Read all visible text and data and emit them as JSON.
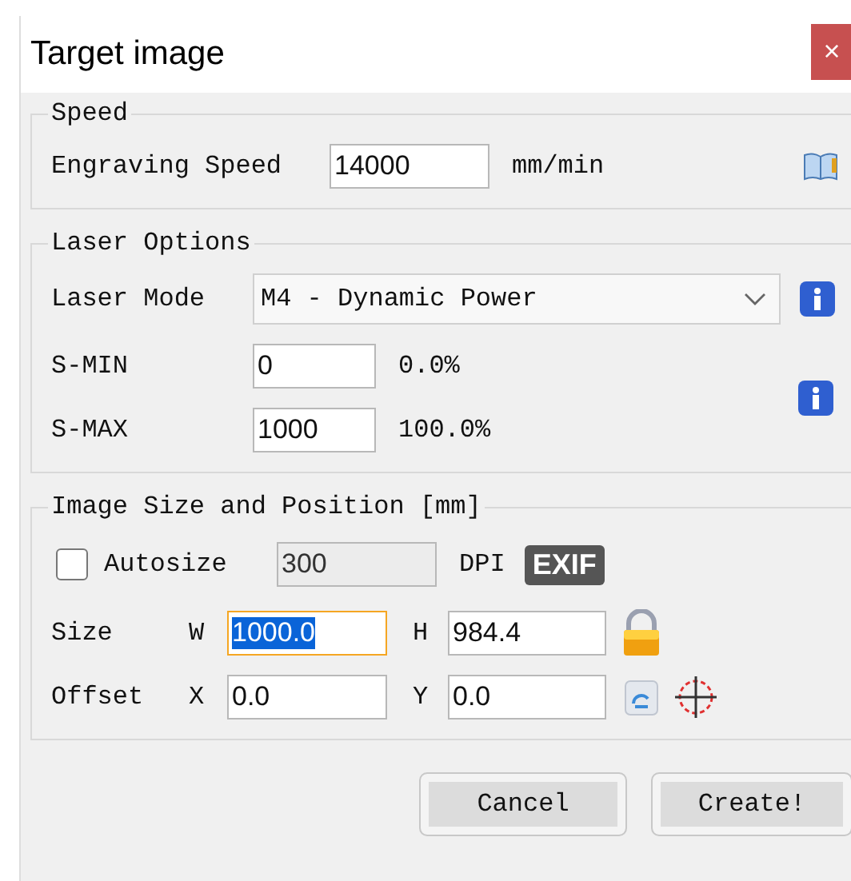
{
  "window": {
    "title": "Target image",
    "close": "×"
  },
  "speed": {
    "legend": "Speed",
    "label": "Engraving Speed",
    "value": "14000",
    "unit": "mm/min"
  },
  "laser_options": {
    "legend": "Laser Options",
    "mode_label": "Laser Mode",
    "mode_value": "M4 - Dynamic Power",
    "s_min": {
      "label": "S-MIN",
      "value": "0",
      "percent": "0.0%"
    },
    "s_max": {
      "label": "S-MAX",
      "value": "1000",
      "percent": "100.0%"
    }
  },
  "image_size": {
    "legend": "Image Size and Position [mm]",
    "autosize": {
      "label": "Autosize",
      "checked": false
    },
    "dpi_value": "300",
    "dpi_label": "DPI",
    "exif": "EXIF",
    "size": {
      "label": "Size",
      "w_label": "W",
      "w_value": "1000.0",
      "w_focused": true,
      "h_label": "H",
      "h_value": "984.4"
    },
    "offset": {
      "label": "Offset",
      "x_label": "X",
      "x_value": "0.0",
      "y_label": "Y",
      "y_value": "0.0"
    }
  },
  "buttons": [
    {
      "label": "Cancel"
    },
    {
      "label": "Create!"
    }
  ]
}
